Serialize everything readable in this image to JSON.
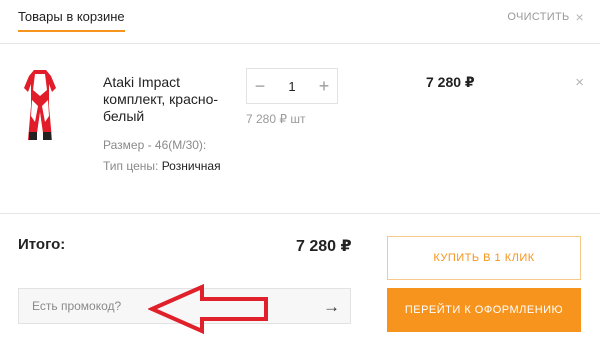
{
  "header": {
    "tab_label": "Товары в корзине",
    "clear_label": "ОЧИСТИТЬ",
    "clear_icon": "×"
  },
  "item": {
    "image_icon": "motocross-suit-red-white",
    "name": "Ataki Impact комплект, красно-белый",
    "size_text": "Размер - 46(M/30):",
    "price_type_label": "Тип цены:",
    "price_type_value": "Розничная",
    "quantity": "1",
    "minus_icon": "−",
    "plus_icon": "+",
    "unit_price": "7 280 ₽ шт",
    "line_total": "7 280 ₽",
    "remove_icon": "×"
  },
  "summary": {
    "total_label": "Итого:",
    "total_value": "7 280 ₽"
  },
  "promo": {
    "placeholder": "Есть промокод?",
    "submit_icon": "→"
  },
  "actions": {
    "one_click_label": "КУПИТЬ В 1 КЛИК",
    "checkout_label": "ПЕРЕЙТИ К ОФОРМЛЕНИЮ"
  },
  "colors": {
    "accent": "#f7941d",
    "annotation_arrow": "#e0202a"
  }
}
